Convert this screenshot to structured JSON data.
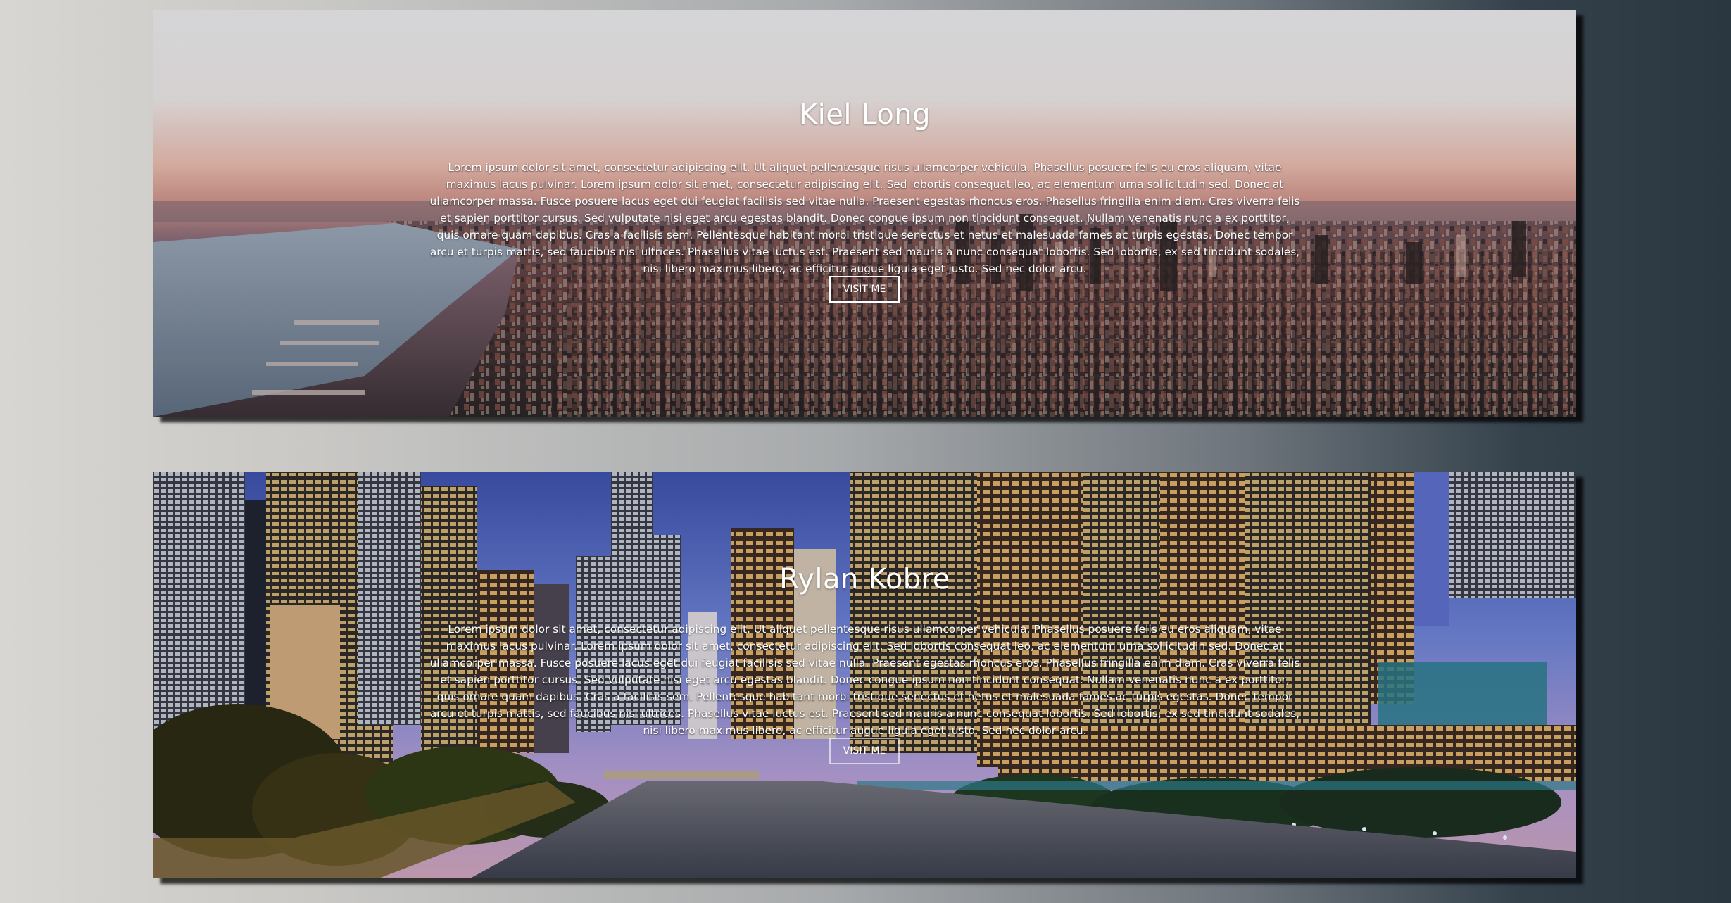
{
  "cards": [
    {
      "title": "Kiel Long",
      "description": "Lorem ipsum dolor sit amet, consectetur adipiscing elit. Ut aliquet pellentesque risus ullamcorper vehicula. Phasellus posuere felis eu eros aliquam, vitae maximus lacus pulvinar. Lorem ipsum dolor sit amet, consectetur adipiscing elit. Sed lobortis consequat leo, ac elementum urna sollicitudin sed. Donec at ullamcorper massa. Fusce posuere lacus eget dui feugiat facilisis sed vitae nulla. Praesent egestas rhoncus eros. Phasellus fringilla enim diam. Cras viverra felis et sapien porttitor cursus. Sed vulputate nisi eget arcu egestas blandit. Donec congue ipsum non tincidunt consequat. Nullam venenatis nunc a ex porttitor, quis ornare quam dapibus. Cras a facilisis sem. Pellentesque habitant morbi tristique senectus et netus et malesuada fames ac turpis egestas. Donec tempor arcu et turpis mattis, sed faucibus nisl ultrices. Phasellus vitae luctus est. Praesent sed mauris a nunc consequat lobortis. Sed lobortis, ex sed tincidunt sodales, nisi libero maximus libero, ac efficitur augue ligula eget justo. Sed nec dolor arcu.",
      "button_label": "VISIT ME",
      "background": "city-sunset-aerial"
    },
    {
      "title": "Rylan Kobre",
      "description": "Lorem ipsum dolor sit amet, consectetur adipiscing elit. Ut aliquet pellentesque risus ullamcorper vehicula. Phasellus posuere felis eu eros aliquam, vitae maximus lacus pulvinar. Lorem ipsum dolor sit amet, consectetur adipiscing elit. Sed lobortis consequat leo, ac elementum urna sollicitudin sed. Donec at ullamcorper massa. Fusce posuere lacus eget dui feugiat facilisis sed vitae nulla. Praesent egestas rhoncus eros. Phasellus fringilla enim diam. Cras viverra felis et sapien porttitor cursus. Sed vulputate nisi eget arcu egestas blandit. Donec congue ipsum non tincidunt consequat. Nullam venenatis nunc a ex porttitor, quis ornare quam dapibus. Cras a facilisis sem. Pellentesque habitant morbi tristique senectus et netus et malesuada fames ac turpis egestas. Donec tempor arcu et turpis mattis, sed faucibus nisl ultrices. Phasellus vitae luctus est. Praesent sed mauris a nunc consequat lobortis. Sed lobortis, ex sed tincidunt sodales, nisi libero maximus libero, ac efficitur augue ligula eget justo. Sed nec dolor arcu.",
      "button_label": "VISIT ME",
      "background": "city-river-night"
    }
  ]
}
